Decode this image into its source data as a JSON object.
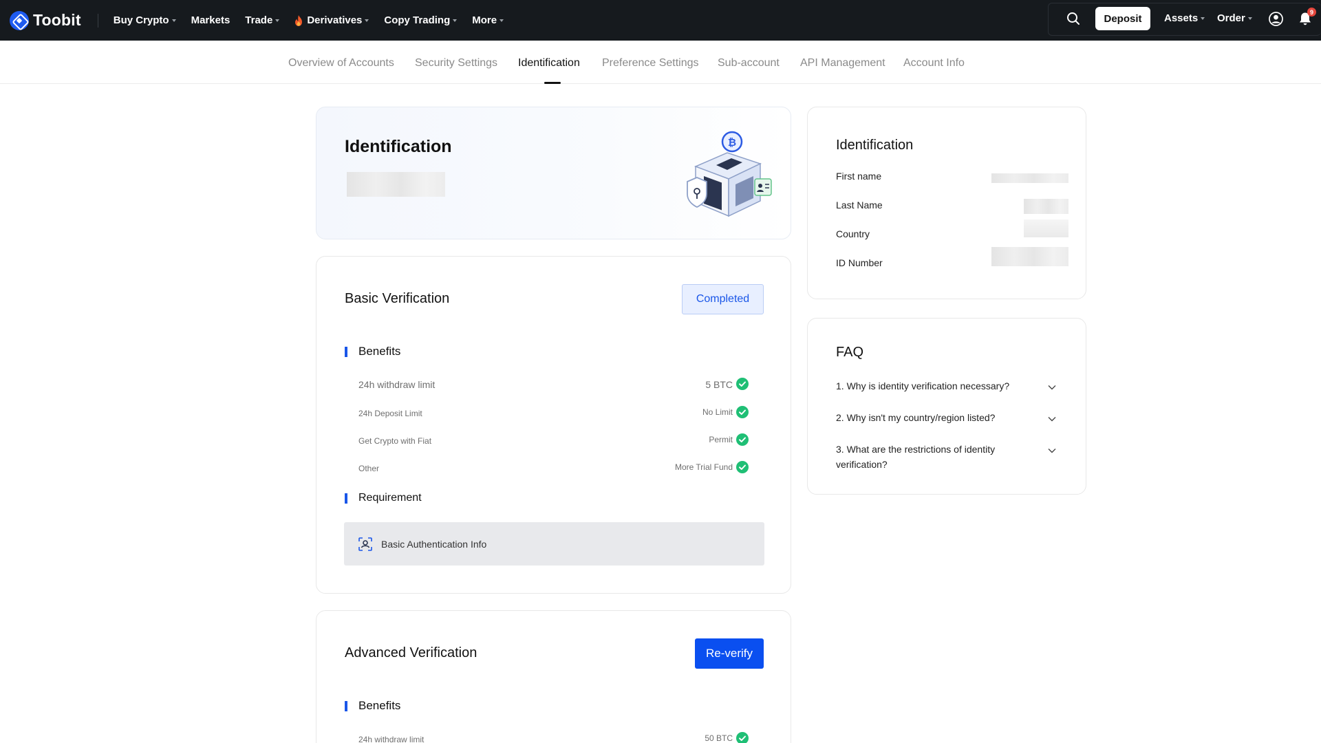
{
  "nav": {
    "brand": "Toobit",
    "items": [
      {
        "label": "Buy Crypto",
        "caret": true
      },
      {
        "label": "Markets",
        "caret": false
      },
      {
        "label": "Trade",
        "caret": true
      },
      {
        "label": "Derivatives",
        "caret": true,
        "icon": "fire-icon"
      },
      {
        "label": "Copy Trading",
        "caret": true
      },
      {
        "label": "More",
        "caret": true
      }
    ],
    "deposit": "Deposit",
    "assets": "Assets",
    "order": "Order",
    "notification_count": "9"
  },
  "tabs": [
    {
      "label": "Overview of Accounts",
      "active": false
    },
    {
      "label": "Security Settings",
      "active": false
    },
    {
      "label": "Identification",
      "active": true
    },
    {
      "label": "Preference Settings",
      "active": false
    },
    {
      "label": "Sub-account",
      "active": false
    },
    {
      "label": "API Management",
      "active": false
    },
    {
      "label": "Account Info",
      "active": false
    }
  ],
  "hero": {
    "title": "Identification"
  },
  "basic": {
    "title": "Basic Verification",
    "status": "Completed",
    "benefits_label": "Benefits",
    "benefits": [
      {
        "label": "24h withdraw limit",
        "value": "5 BTC"
      },
      {
        "label": "24h Deposit Limit",
        "value": "No Limit"
      },
      {
        "label": "Get Crypto with Fiat",
        "value": "Permit"
      },
      {
        "label": "Other",
        "value": "More Trial Fund"
      }
    ],
    "requirement_label": "Requirement",
    "requirement_item": "Basic Authentication Info"
  },
  "advanced": {
    "title": "Advanced Verification",
    "action": "Re-verify",
    "benefits_label": "Benefits",
    "benefits": [
      {
        "label": "24h withdraw limit",
        "value": "50 BTC"
      }
    ]
  },
  "info": {
    "title": "Identification",
    "fields": [
      {
        "label": "First name"
      },
      {
        "label": "Last Name"
      },
      {
        "label": "Country"
      },
      {
        "label": "ID Number"
      }
    ]
  },
  "faq": {
    "title": "FAQ",
    "questions": [
      "1. Why is identity verification necessary?",
      "2. Why isn't my country/region listed?",
      "3. What are the restrictions of identity verification?"
    ]
  },
  "colors": {
    "accent": "#1a56e8",
    "success": "#1fbf75",
    "nav_bg": "#161a1e"
  }
}
